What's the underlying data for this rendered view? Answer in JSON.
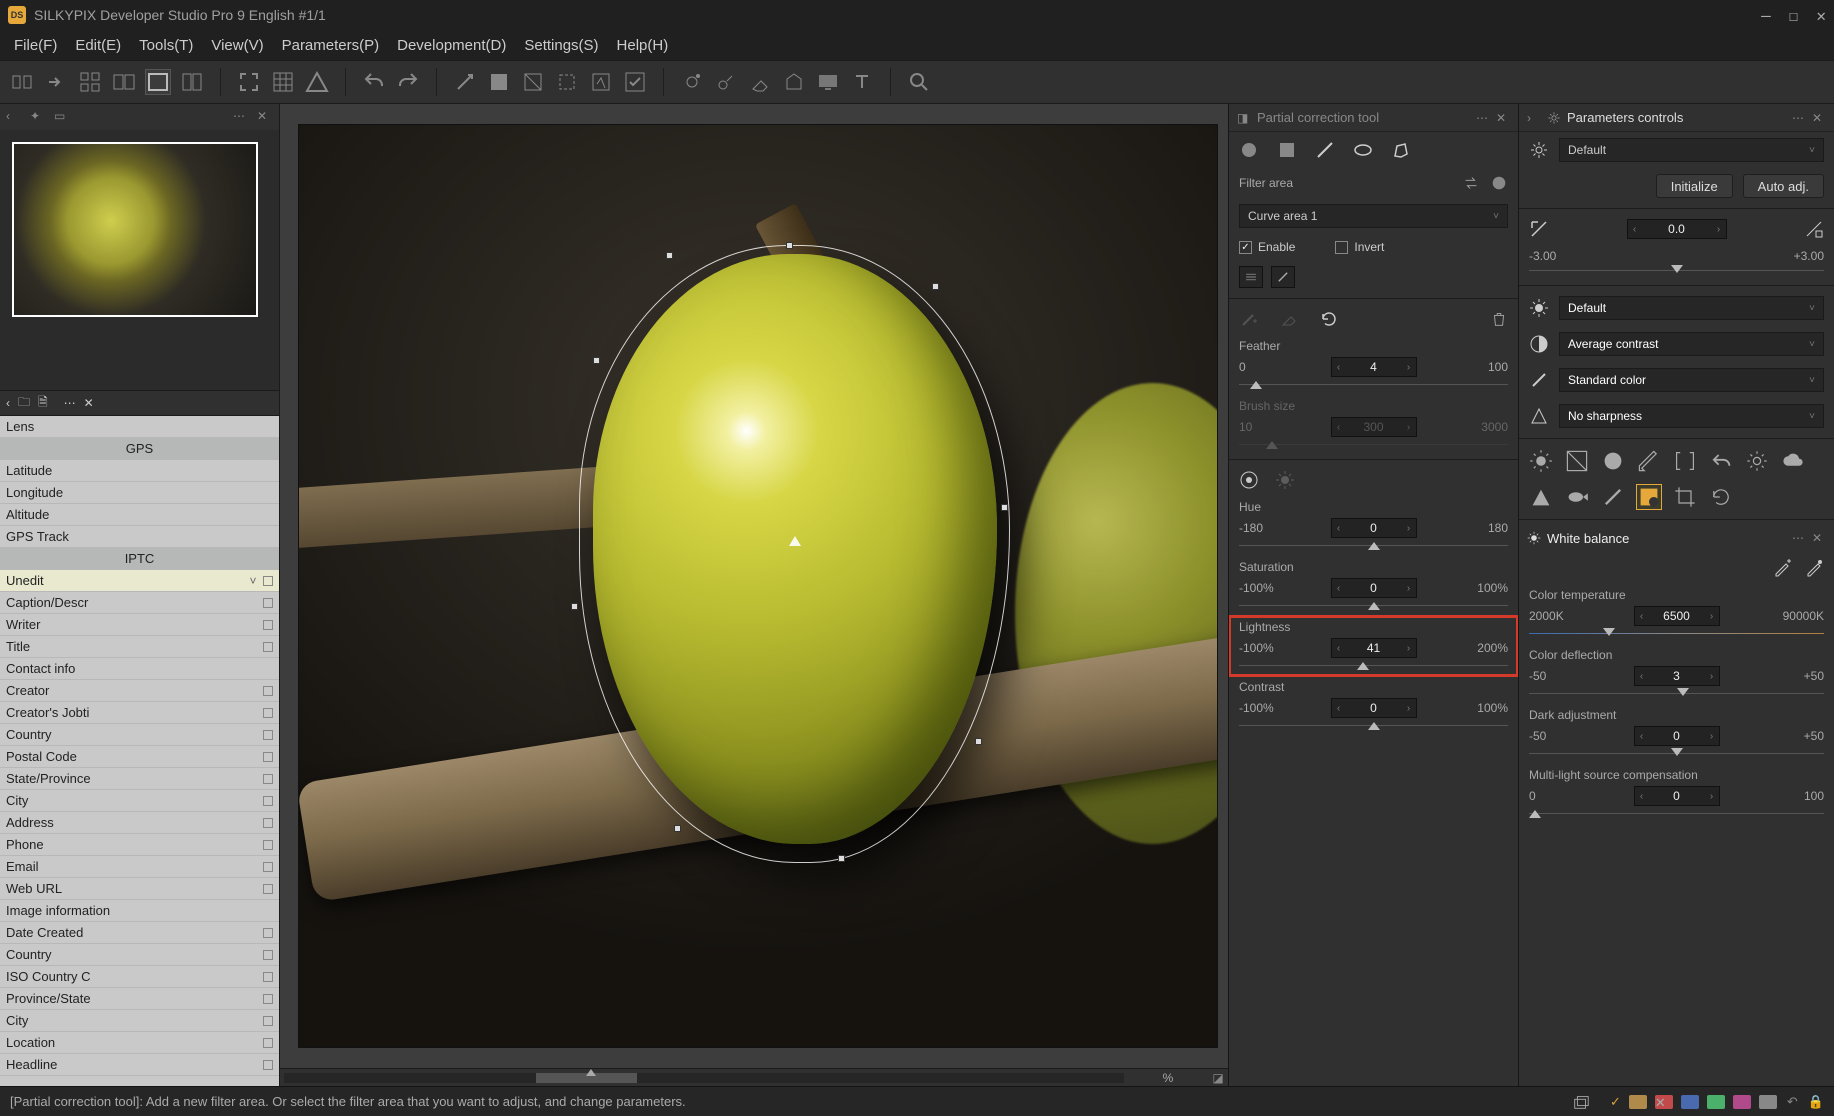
{
  "app": {
    "title": "SILKYPIX Developer Studio Pro 9 English   #1/1"
  },
  "menu": {
    "file": "File(F)",
    "edit": "Edit(E)",
    "tools": "Tools(T)",
    "view": "View(V)",
    "parameters": "Parameters(P)",
    "development": "Development(D)",
    "settings": "Settings(S)",
    "help": "Help(H)"
  },
  "left": {
    "lens": "Lens",
    "gps_section": "GPS",
    "gps": {
      "latitude": "Latitude",
      "longitude": "Longitude",
      "altitude": "Altitude",
      "track": "GPS Track"
    },
    "iptc_section": "IPTC",
    "unedit": "Unedit",
    "iptc": [
      "Caption/Descr",
      "Writer",
      "Title",
      "Contact info",
      "Creator",
      "Creator's Jobti",
      "Country",
      "Postal Code",
      "State/Province",
      "City",
      "Address",
      "Phone",
      "Email",
      "Web URL",
      "Image information",
      "Date Created",
      "Country",
      "ISO Country C",
      "Province/State",
      "City",
      "Location",
      "Headline"
    ]
  },
  "pct_label": "%",
  "partial": {
    "title": "Partial correction tool",
    "filter_area": "Filter area",
    "curve_area": "Curve area 1",
    "enable": "Enable",
    "invert": "Invert",
    "feather": {
      "label": "Feather",
      "min": "0",
      "val": "4",
      "max": "100"
    },
    "brush": {
      "label": "Brush size",
      "min": "10",
      "val": "300",
      "max": "3000"
    },
    "hue": {
      "label": "Hue",
      "min": "-180",
      "val": "0",
      "max": "180"
    },
    "sat": {
      "label": "Saturation",
      "min": "-100%",
      "val": "0",
      "max": "100%"
    },
    "light": {
      "label": "Lightness",
      "min": "-100%",
      "val": "41",
      "max": "200%"
    },
    "contrast": {
      "label": "Contrast",
      "min": "-100%",
      "val": "0",
      "max": "100%"
    }
  },
  "params": {
    "title": "Parameters controls",
    "preset": "Default",
    "init": "Initialize",
    "auto": "Auto adj.",
    "exposure": {
      "val": "0.0",
      "min": "-3.00",
      "max": "+3.00"
    },
    "wb_preset": "Default",
    "contrast_preset": "Average contrast",
    "color_preset": "Standard color",
    "sharp_preset": "No sharpness",
    "wb_title": "White balance",
    "ct": {
      "label": "Color temperature",
      "min": "2000K",
      "val": "6500",
      "max": "90000K"
    },
    "cd": {
      "label": "Color deflection",
      "min": "-50",
      "val": "3",
      "max": "+50"
    },
    "da": {
      "label": "Dark adjustment",
      "min": "-50",
      "val": "0",
      "max": "+50"
    },
    "ml": {
      "label": "Multi-light source compensation",
      "min": "0",
      "val": "0",
      "max": "100"
    }
  },
  "status": {
    "text": "[Partial correction tool]: Add a new filter area. Or select the filter area that you want to adjust, and change parameters."
  }
}
